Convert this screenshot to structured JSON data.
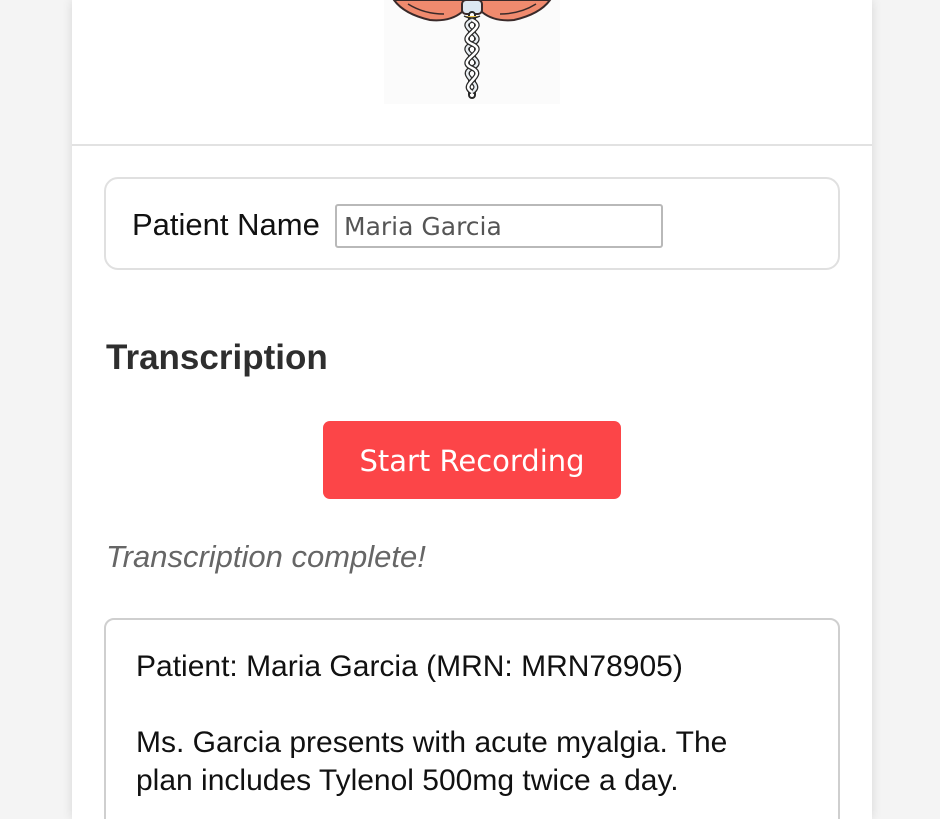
{
  "patient": {
    "label": "Patient Name",
    "name_value": "Maria Garcia"
  },
  "transcription": {
    "heading": "Transcription",
    "record_button_label": "Start Recording",
    "status": "Transcription complete!",
    "text_line_1": "Patient: Maria Garcia (MRN: MRN78905)",
    "text_line_2": "Ms. Garcia presents with acute myalgia. The",
    "text_line_3": "plan includes Tylenol 500mg twice a day."
  },
  "colors": {
    "record_button": "#fc4548",
    "logo_wings": "#f08a6e"
  },
  "icons": {
    "logo": "caduceus-logo"
  }
}
